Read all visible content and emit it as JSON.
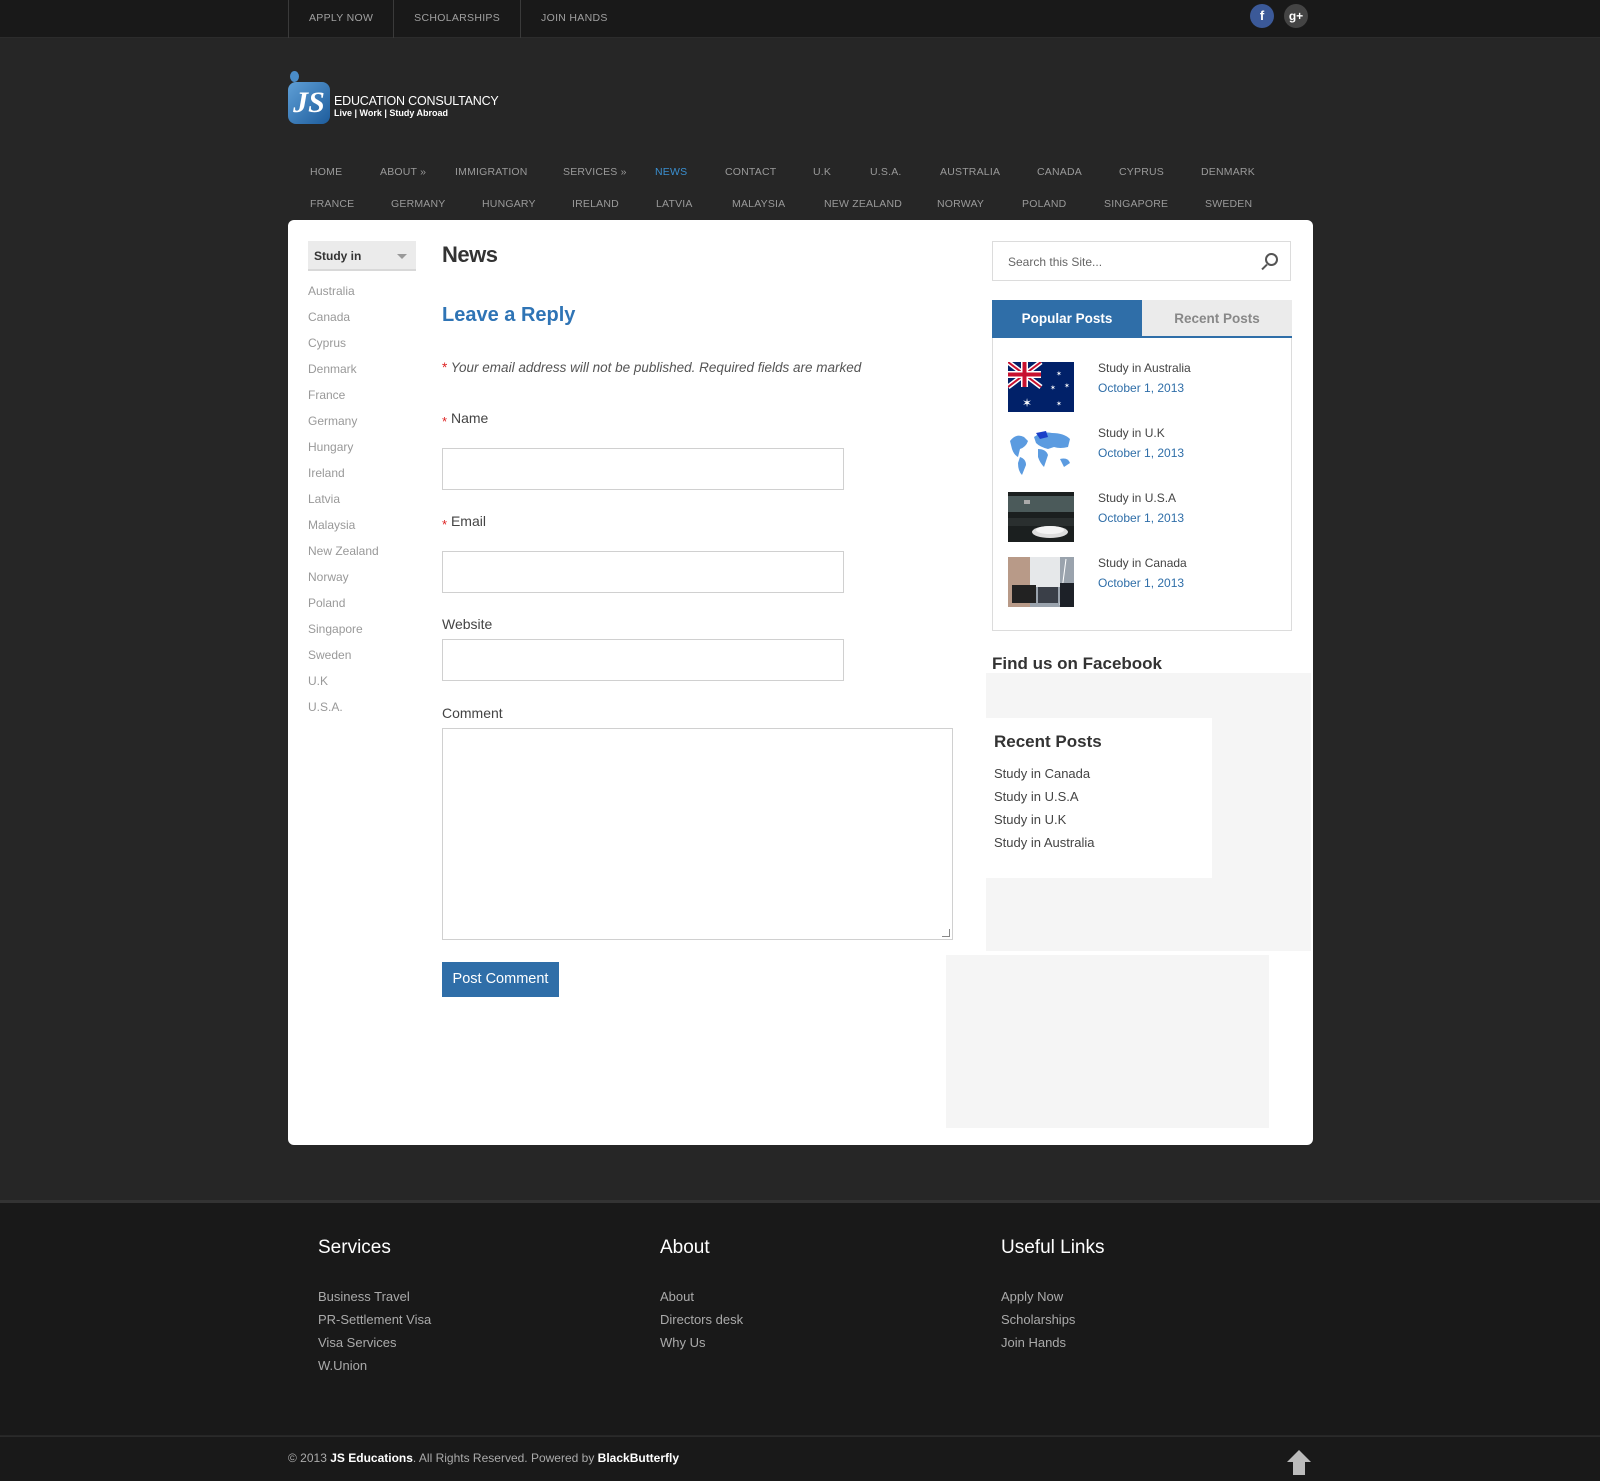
{
  "topbar": {
    "links": [
      "APPLY NOW",
      "SCHOLARSHIPS",
      "JOIN HANDS"
    ],
    "social": [
      {
        "icon": "facebook-icon",
        "glyph": "f"
      },
      {
        "icon": "google-plus-icon",
        "glyph": "g+"
      }
    ]
  },
  "logo": {
    "mark": "JS",
    "line1": "EDUCATION CONSULTANCY",
    "line2": "Live | Work | Study Abroad"
  },
  "nav": {
    "row1": [
      "HOME",
      "ABOUT »",
      "IMMIGRATION",
      "SERVICES »",
      "NEWS",
      "CONTACT",
      "U.K",
      "U.S.A.",
      "AUSTRALIA",
      "CANADA",
      "CYPRUS",
      "DENMARK"
    ],
    "row2": [
      "FRANCE",
      "GERMANY",
      "HUNGARY",
      "IRELAND",
      "LATVIA",
      "MALAYSIA",
      "NEW ZEALAND",
      "NORWAY",
      "POLAND",
      "SINGAPORE",
      "SWEDEN"
    ],
    "active": "NEWS",
    "active_color": "#3a8fd0"
  },
  "sidebar": {
    "select_label": "Study in",
    "countries": [
      "Australia",
      "Canada",
      "Cyprus",
      "Denmark",
      "France",
      "Germany",
      "Hungary",
      "Ireland",
      "Latvia",
      "Malaysia",
      "New Zealand",
      "Norway",
      "Poland",
      "Singapore",
      "Sweden",
      "U.K",
      "U.S.A."
    ]
  },
  "main": {
    "page_title": "News",
    "reply_title": "Leave a Reply",
    "required_star": "*",
    "notes": "Your email address will not be published. Required fields are marked",
    "name_label": "Name",
    "email_label": "Email",
    "website_label": "Website",
    "comment_label": "Comment",
    "submit_label": "Post Comment"
  },
  "search": {
    "placeholder": "Search this Site..."
  },
  "tabs": {
    "popular": "Popular Posts",
    "recent": "Recent Posts"
  },
  "popular_posts": [
    {
      "title": "Study in Australia",
      "date": "October 1, 2013",
      "thumb": "australia-flag"
    },
    {
      "title": "Study in U.K",
      "date": "October 1, 2013",
      "thumb": "world-map"
    },
    {
      "title": "Study in U.S.A",
      "date": "October 1, 2013",
      "thumb": "computer-mouse"
    },
    {
      "title": "Study in Canada",
      "date": "October 1, 2013",
      "thumb": "classroom"
    }
  ],
  "facebook_title": "Find us on Facebook",
  "recent_widget": {
    "title": "Recent Posts",
    "items": [
      "Study in Canada",
      "Study in U.S.A",
      "Study in U.K",
      "Study in Australia"
    ]
  },
  "footer": {
    "services": {
      "title": "Services",
      "items": [
        "Business Travel",
        "PR-Settlement Visa",
        "Visa Services",
        "W.Union"
      ]
    },
    "about": {
      "title": "About",
      "items": [
        "About",
        "Directors desk",
        "Why Us"
      ]
    },
    "useful": {
      "title": "Useful Links",
      "items": [
        "Apply Now",
        "Scholarships",
        "Join Hands"
      ]
    }
  },
  "copyright": {
    "prefix": "© 2013 ",
    "company": "JS Educations",
    "middle": ". All Rights Reserved. Powered by ",
    "powered": "BlackButterfly"
  },
  "colors": {
    "accent": "#2f6ea8",
    "background": "#262626"
  }
}
